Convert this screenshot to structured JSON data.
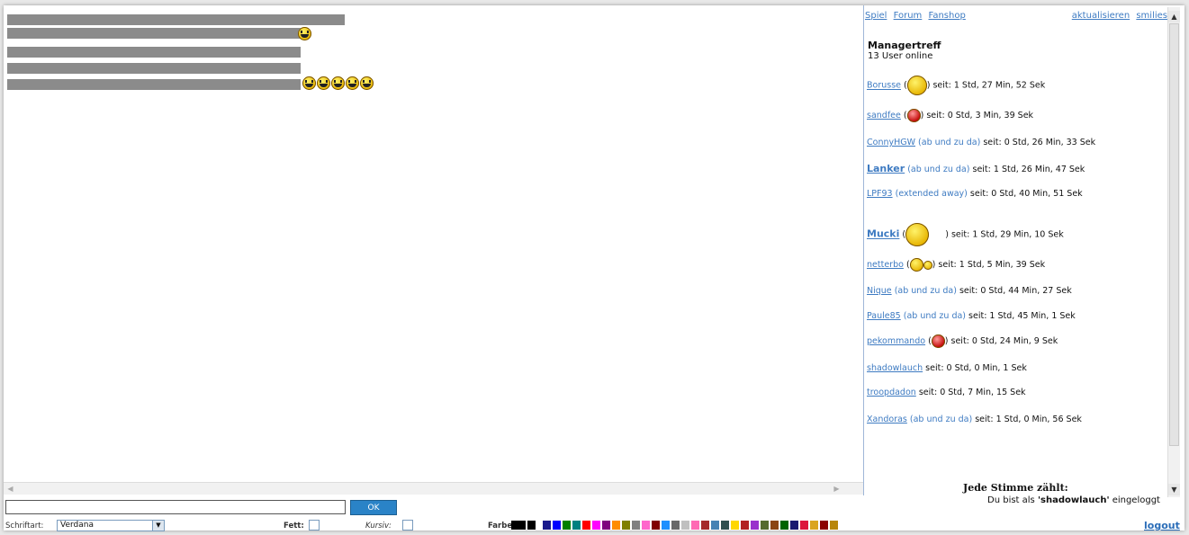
{
  "topbar": {
    "links": [
      "Spiel",
      "Forum",
      "Fanshop"
    ],
    "right_links": [
      "aktualisieren",
      "smilies"
    ]
  },
  "room": {
    "title": "Managertreff",
    "online": "13 User online"
  },
  "users": [
    {
      "name": "Borusse",
      "status": "",
      "since": "seit: 1 Std, 27 Min, 52 Sek",
      "bold": false
    },
    {
      "name": "sandfee",
      "status": "",
      "since": "seit: 0 Std, 3 Min, 39 Sek",
      "bold": false
    },
    {
      "name": "ConnyHGW",
      "status": "(ab und zu da)",
      "since": "seit: 0 Std, 26 Min, 33 Sek",
      "bold": false
    },
    {
      "name": "Lanker",
      "status": "(ab und zu da)",
      "since": "seit: 1 Std, 26 Min, 47 Sek",
      "bold": true
    },
    {
      "name": "LPF93",
      "status": "(extended away)",
      "since": "seit: 0 Std, 40 Min, 51 Sek",
      "bold": false
    },
    {
      "name": "Mucki",
      "status": "",
      "since": "seit: 1 Std, 29 Min, 10 Sek",
      "bold": true
    },
    {
      "name": "netterbo",
      "status": "",
      "since": "seit: 1 Std, 5 Min, 39 Sek",
      "bold": false
    },
    {
      "name": "Nique",
      "status": "(ab und zu da)",
      "since": "seit: 0 Std, 44 Min, 27 Sek",
      "bold": false
    },
    {
      "name": "Paule85",
      "status": "(ab und zu da)",
      "since": "seit: 1 Std, 45 Min, 1 Sek",
      "bold": false
    },
    {
      "name": "pekommando",
      "status": "",
      "since": "seit: 0 Std, 24 Min, 9 Sek",
      "bold": false
    },
    {
      "name": "shadowlauch",
      "status": "",
      "since": "seit: 0 Std, 0 Min, 1 Sek",
      "bold": false
    },
    {
      "name": "troopdadon",
      "status": "",
      "since": "seit: 0 Std, 7 Min, 15 Sek",
      "bold": false
    },
    {
      "name": "Xandoras",
      "status": "(ab und zu da)",
      "since": "seit: 1 Std, 0 Min, 56 Sek",
      "bold": false
    }
  ],
  "footer": {
    "slogan": "Jede Stimme zählt:",
    "logged_prefix": "Du bist als ",
    "logged_user": "'shadowlauch'",
    "logged_suffix": " eingeloggt",
    "logout": "logout"
  },
  "input": {
    "value": "",
    "ok_label": "OK"
  },
  "controls": {
    "font_label": "Schriftart:",
    "font_value": "Verdana",
    "bold_label": "Fett:",
    "italic_label": "Kursiv:",
    "color_label": "Farbe:",
    "colors": [
      "#000000",
      "#000000",
      "#1a1a8c",
      "#0000ff",
      "#008000",
      "#008080",
      "#ff0000",
      "#ff00ff",
      "#800080",
      "#ff8c00",
      "#808000",
      "#808080",
      "#ff66cc",
      "#800000",
      "#1e90ff",
      "#696969",
      "#c0c0c0",
      "#ff69b4",
      "#a52a2a",
      "#4682b4",
      "#2f4f4f",
      "#ffd700",
      "#b22222",
      "#9932cc",
      "#556b2f",
      "#8b4513",
      "#006400",
      "#191970",
      "#dc143c",
      "#daa520",
      "#8b0000",
      "#b8860b"
    ]
  }
}
